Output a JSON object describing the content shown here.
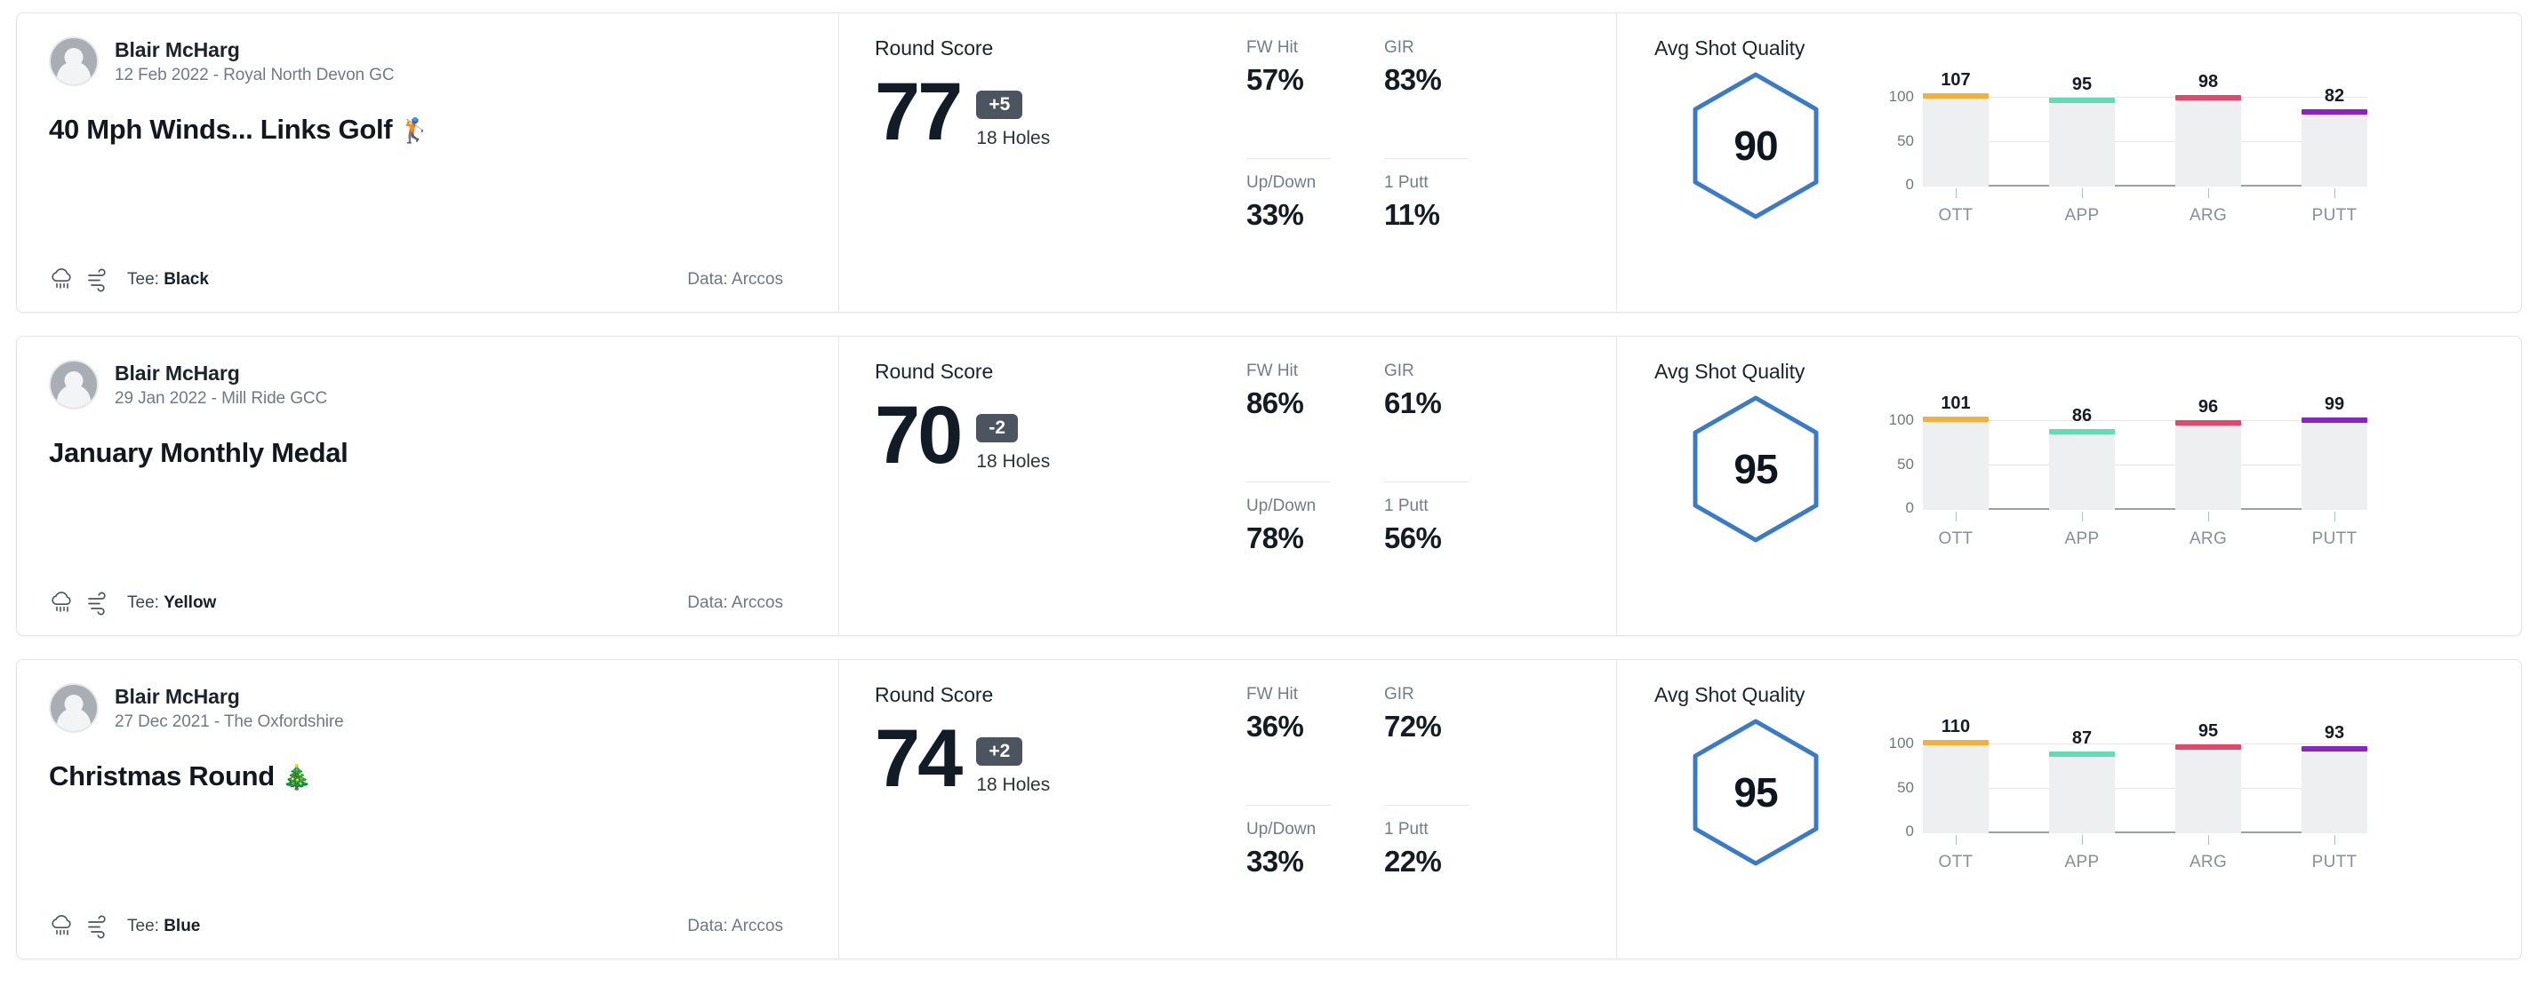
{
  "theme": {
    "accent_blue": "#3a7bc8",
    "badge_gray": "#4c555f",
    "bar_track": "#eeeff0",
    "text_dark": "#111c26",
    "text_muted": "#737d89"
  },
  "labels": {
    "round_score_heading": "Round Score",
    "shot_quality_heading": "Avg Shot Quality",
    "holes": "18 Holes",
    "stat_fw": "FW Hit",
    "stat_gir": "GIR",
    "stat_updown": "Up/Down",
    "stat_1putt": "1 Putt",
    "data_source": "Data: Arccos",
    "tee_prefix": "Tee: "
  },
  "chart_axis": {
    "yticks": [
      "100",
      "50",
      "0"
    ],
    "categories": [
      "OTT",
      "APP",
      "ARG",
      "PUTT"
    ],
    "ylim": [
      0,
      100
    ],
    "gridlines": [
      100,
      50,
      0
    ]
  },
  "series_colors": {
    "OTT": "#f0b23c",
    "APP": "#63dbb4",
    "ARG": "#e2486b",
    "PUTT": "#8b23c4"
  },
  "rounds": [
    {
      "player": "Blair McHarg",
      "subtitle": "12 Feb 2022 - Royal North Devon GC",
      "title": "40 Mph Winds... Links Golf",
      "title_emoji": "🏌️",
      "tee": "Black",
      "score": "77",
      "diff": "+5",
      "fw_hit": "57%",
      "gir": "83%",
      "up_down": "33%",
      "one_putt": "11%",
      "shot_quality": "90",
      "chart_data": {
        "type": "bar",
        "title": "Avg Shot Quality",
        "categories": [
          "OTT",
          "APP",
          "ARG",
          "PUTT"
        ],
        "values": [
          107,
          95,
          98,
          82
        ],
        "ylim": [
          0,
          100
        ],
        "ylabel": "",
        "xlabel": "",
        "grid": true,
        "legend": "none"
      }
    },
    {
      "player": "Blair McHarg",
      "subtitle": "29 Jan 2022 - Mill Ride GCC",
      "title": "January Monthly Medal",
      "title_emoji": "",
      "tee": "Yellow",
      "score": "70",
      "diff": "-2",
      "fw_hit": "86%",
      "gir": "61%",
      "up_down": "78%",
      "one_putt": "56%",
      "shot_quality": "95",
      "chart_data": {
        "type": "bar",
        "title": "Avg Shot Quality",
        "categories": [
          "OTT",
          "APP",
          "ARG",
          "PUTT"
        ],
        "values": [
          101,
          86,
          96,
          99
        ],
        "ylim": [
          0,
          100
        ],
        "ylabel": "",
        "xlabel": "",
        "grid": true,
        "legend": "none"
      }
    },
    {
      "player": "Blair McHarg",
      "subtitle": "27 Dec 2021 - The Oxfordshire",
      "title": "Christmas Round",
      "title_emoji": "🎄",
      "tee": "Blue",
      "score": "74",
      "diff": "+2",
      "fw_hit": "36%",
      "gir": "72%",
      "up_down": "33%",
      "one_putt": "22%",
      "shot_quality": "95",
      "chart_data": {
        "type": "bar",
        "title": "Avg Shot Quality",
        "categories": [
          "OTT",
          "APP",
          "ARG",
          "PUTT"
        ],
        "values": [
          110,
          87,
          95,
          93
        ],
        "ylim": [
          0,
          100
        ],
        "ylabel": "",
        "xlabel": "",
        "grid": true,
        "legend": "none"
      }
    }
  ]
}
